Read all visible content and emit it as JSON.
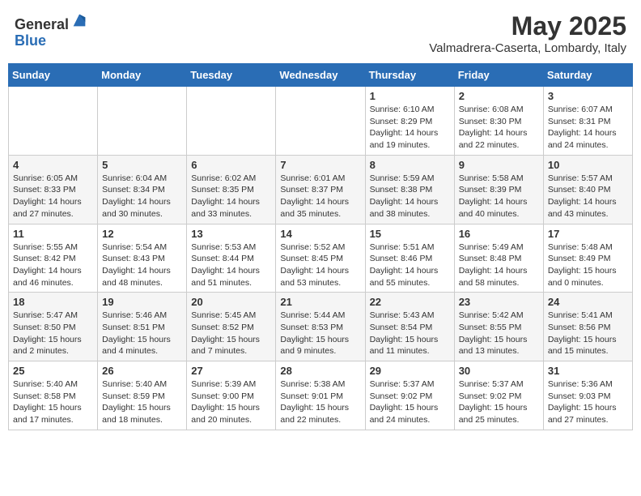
{
  "header": {
    "logo_line1": "General",
    "logo_line2": "Blue",
    "month": "May 2025",
    "location": "Valmadrera-Caserta, Lombardy, Italy"
  },
  "weekdays": [
    "Sunday",
    "Monday",
    "Tuesday",
    "Wednesday",
    "Thursday",
    "Friday",
    "Saturday"
  ],
  "weeks": [
    [
      {
        "day": "",
        "info": ""
      },
      {
        "day": "",
        "info": ""
      },
      {
        "day": "",
        "info": ""
      },
      {
        "day": "",
        "info": ""
      },
      {
        "day": "1",
        "info": "Sunrise: 6:10 AM\nSunset: 8:29 PM\nDaylight: 14 hours\nand 19 minutes."
      },
      {
        "day": "2",
        "info": "Sunrise: 6:08 AM\nSunset: 8:30 PM\nDaylight: 14 hours\nand 22 minutes."
      },
      {
        "day": "3",
        "info": "Sunrise: 6:07 AM\nSunset: 8:31 PM\nDaylight: 14 hours\nand 24 minutes."
      }
    ],
    [
      {
        "day": "4",
        "info": "Sunrise: 6:05 AM\nSunset: 8:33 PM\nDaylight: 14 hours\nand 27 minutes."
      },
      {
        "day": "5",
        "info": "Sunrise: 6:04 AM\nSunset: 8:34 PM\nDaylight: 14 hours\nand 30 minutes."
      },
      {
        "day": "6",
        "info": "Sunrise: 6:02 AM\nSunset: 8:35 PM\nDaylight: 14 hours\nand 33 minutes."
      },
      {
        "day": "7",
        "info": "Sunrise: 6:01 AM\nSunset: 8:37 PM\nDaylight: 14 hours\nand 35 minutes."
      },
      {
        "day": "8",
        "info": "Sunrise: 5:59 AM\nSunset: 8:38 PM\nDaylight: 14 hours\nand 38 minutes."
      },
      {
        "day": "9",
        "info": "Sunrise: 5:58 AM\nSunset: 8:39 PM\nDaylight: 14 hours\nand 40 minutes."
      },
      {
        "day": "10",
        "info": "Sunrise: 5:57 AM\nSunset: 8:40 PM\nDaylight: 14 hours\nand 43 minutes."
      }
    ],
    [
      {
        "day": "11",
        "info": "Sunrise: 5:55 AM\nSunset: 8:42 PM\nDaylight: 14 hours\nand 46 minutes."
      },
      {
        "day": "12",
        "info": "Sunrise: 5:54 AM\nSunset: 8:43 PM\nDaylight: 14 hours\nand 48 minutes."
      },
      {
        "day": "13",
        "info": "Sunrise: 5:53 AM\nSunset: 8:44 PM\nDaylight: 14 hours\nand 51 minutes."
      },
      {
        "day": "14",
        "info": "Sunrise: 5:52 AM\nSunset: 8:45 PM\nDaylight: 14 hours\nand 53 minutes."
      },
      {
        "day": "15",
        "info": "Sunrise: 5:51 AM\nSunset: 8:46 PM\nDaylight: 14 hours\nand 55 minutes."
      },
      {
        "day": "16",
        "info": "Sunrise: 5:49 AM\nSunset: 8:48 PM\nDaylight: 14 hours\nand 58 minutes."
      },
      {
        "day": "17",
        "info": "Sunrise: 5:48 AM\nSunset: 8:49 PM\nDaylight: 15 hours\nand 0 minutes."
      }
    ],
    [
      {
        "day": "18",
        "info": "Sunrise: 5:47 AM\nSunset: 8:50 PM\nDaylight: 15 hours\nand 2 minutes."
      },
      {
        "day": "19",
        "info": "Sunrise: 5:46 AM\nSunset: 8:51 PM\nDaylight: 15 hours\nand 4 minutes."
      },
      {
        "day": "20",
        "info": "Sunrise: 5:45 AM\nSunset: 8:52 PM\nDaylight: 15 hours\nand 7 minutes."
      },
      {
        "day": "21",
        "info": "Sunrise: 5:44 AM\nSunset: 8:53 PM\nDaylight: 15 hours\nand 9 minutes."
      },
      {
        "day": "22",
        "info": "Sunrise: 5:43 AM\nSunset: 8:54 PM\nDaylight: 15 hours\nand 11 minutes."
      },
      {
        "day": "23",
        "info": "Sunrise: 5:42 AM\nSunset: 8:55 PM\nDaylight: 15 hours\nand 13 minutes."
      },
      {
        "day": "24",
        "info": "Sunrise: 5:41 AM\nSunset: 8:56 PM\nDaylight: 15 hours\nand 15 minutes."
      }
    ],
    [
      {
        "day": "25",
        "info": "Sunrise: 5:40 AM\nSunset: 8:58 PM\nDaylight: 15 hours\nand 17 minutes."
      },
      {
        "day": "26",
        "info": "Sunrise: 5:40 AM\nSunset: 8:59 PM\nDaylight: 15 hours\nand 18 minutes."
      },
      {
        "day": "27",
        "info": "Sunrise: 5:39 AM\nSunset: 9:00 PM\nDaylight: 15 hours\nand 20 minutes."
      },
      {
        "day": "28",
        "info": "Sunrise: 5:38 AM\nSunset: 9:01 PM\nDaylight: 15 hours\nand 22 minutes."
      },
      {
        "day": "29",
        "info": "Sunrise: 5:37 AM\nSunset: 9:02 PM\nDaylight: 15 hours\nand 24 minutes."
      },
      {
        "day": "30",
        "info": "Sunrise: 5:37 AM\nSunset: 9:02 PM\nDaylight: 15 hours\nand 25 minutes."
      },
      {
        "day": "31",
        "info": "Sunrise: 5:36 AM\nSunset: 9:03 PM\nDaylight: 15 hours\nand 27 minutes."
      }
    ]
  ]
}
